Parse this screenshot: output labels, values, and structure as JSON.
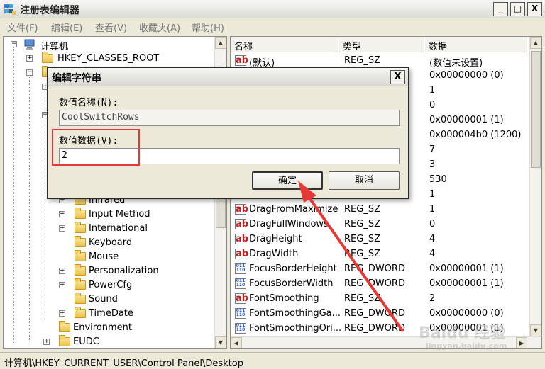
{
  "window": {
    "title": "注册表编辑器",
    "min_glyph": "_",
    "max_glyph": "□",
    "close_glyph": "X"
  },
  "menu": [
    "文件(F)",
    "编辑(E)",
    "查看(V)",
    "收藏夹(A)",
    "帮助(H)"
  ],
  "tree": {
    "root": "计算机",
    "items": [
      "HKEY_CLASSES_ROOT",
      "Infrared",
      "Input Method",
      "International",
      "Keyboard",
      "Mouse",
      "Personalization",
      "PowerCfg",
      "Sound",
      "TimeDate",
      "Environment",
      "EUDC"
    ]
  },
  "list": {
    "columns": [
      "名称",
      "类型",
      "数据"
    ],
    "rows_right": [
      {
        "data": "(数值未设置)"
      },
      {
        "data": "0x00000000 (0)"
      },
      {
        "data": "1"
      },
      {
        "data": "0"
      },
      {
        "data": "0x00000001 (1)"
      },
      {
        "data": "0x000004b0 (1200)"
      },
      {
        "data": "7"
      },
      {
        "data": "3"
      },
      {
        "data": "530"
      },
      {
        "data": "1"
      }
    ],
    "first_row": {
      "name": "(默认)",
      "type": "REG_SZ",
      "icon": "ab"
    },
    "rows": [
      {
        "name": "DragFromMaximize",
        "type": "REG_SZ",
        "data": "1",
        "icon": "ab"
      },
      {
        "name": "DragFullWindows",
        "type": "REG_SZ",
        "data": "0",
        "icon": "ab"
      },
      {
        "name": "DragHeight",
        "type": "REG_SZ",
        "data": "4",
        "icon": "ab"
      },
      {
        "name": "DragWidth",
        "type": "REG_SZ",
        "data": "4",
        "icon": "ab"
      },
      {
        "name": "FocusBorderHeight",
        "type": "REG_DWORD",
        "data": "0x00000001 (1)",
        "icon": "dw"
      },
      {
        "name": "FocusBorderWidth",
        "type": "REG_DWORD",
        "data": "0x00000001 (1)",
        "icon": "dw"
      },
      {
        "name": "FontSmoothing",
        "type": "REG_SZ",
        "data": "2",
        "icon": "ab"
      },
      {
        "name": "FontSmoothingGa...",
        "type": "REG_DWORD",
        "data": "0x00000000 (0)",
        "icon": "dw"
      },
      {
        "name": "FontSmoothingOri...",
        "type": "REG_DWORD",
        "data": "0x00000001 (1)",
        "icon": "dw"
      }
    ]
  },
  "status": "计算机\\HKEY_CURRENT_USER\\Control Panel\\Desktop",
  "dialog": {
    "title": "编辑字符串",
    "close_glyph": "X",
    "name_label": "数值名称(N):",
    "name_value": "CoolSwitchRows",
    "data_label": "数值数据(V):",
    "data_value": "2",
    "ok_label": "确定",
    "cancel_label": "取消"
  },
  "watermark": {
    "main": "Baidu 经验",
    "sub": "jingyan.baidu.com"
  },
  "colors": {
    "highlight": "#e53935"
  }
}
